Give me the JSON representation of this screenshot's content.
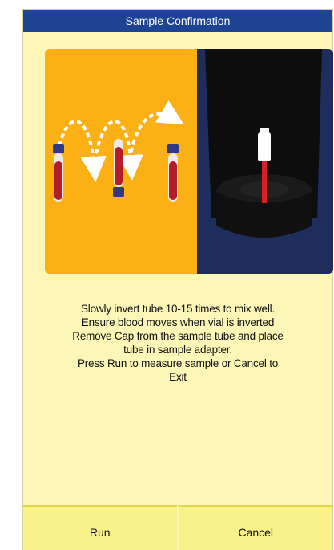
{
  "window": {
    "title": "Sample Confirmation"
  },
  "illustration": {
    "left_panel_color": "#fbb016",
    "right_panel_color": "#1e2d5c",
    "left_icon": "invert-tube-arrows-icon",
    "right_icon": "tube-in-adapter-icon"
  },
  "instructions": {
    "line1": "Slowly invert tube 10-15 times to mix well.",
    "line2": "Ensure blood moves when vial is inverted",
    "line3": "Remove Cap from the sample tube and place",
    "line4": "tube in sample adapter.",
    "line5": "Press Run to measure sample or Cancel to",
    "line6": "Exit"
  },
  "buttons": {
    "run": "Run",
    "cancel": "Cancel"
  },
  "colors": {
    "title_bar": "#1f4393",
    "background": "#fdf7b7",
    "button": "#fbf18a"
  }
}
